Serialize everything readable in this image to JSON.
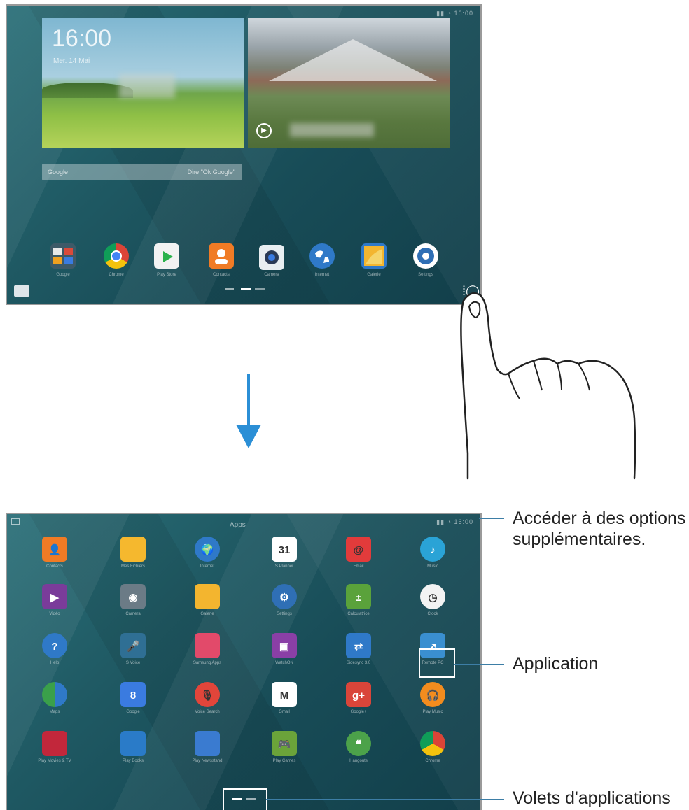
{
  "home": {
    "clock_time": "16:00",
    "clock_date": "Mer. 14 Mai",
    "search_left": "Google",
    "search_right": "Dire \"Ok Google\"",
    "dock": [
      {
        "label": "Google",
        "icon": "folder-apps-icon",
        "color": "#4a6b7a"
      },
      {
        "label": "Chrome",
        "icon": "chrome-icon",
        "color": "#e04a3a"
      },
      {
        "label": "Play Store",
        "icon": "play-store-icon",
        "color": "#f2f2f2"
      },
      {
        "label": "Contacts",
        "icon": "contacts-icon",
        "color": "#f07b25"
      },
      {
        "label": "Camera",
        "icon": "camera-icon",
        "color": "#6b7b86"
      },
      {
        "label": "Internet",
        "icon": "internet-icon",
        "color": "#2f79c8"
      },
      {
        "label": "Galerie",
        "icon": "gallery-icon",
        "color": "#f3b52f"
      },
      {
        "label": "Settings",
        "icon": "settings-icon",
        "color": "#2f6fb5"
      }
    ]
  },
  "apps": {
    "title": "Apps",
    "grid": [
      {
        "label": "Contacts",
        "icon": "contacts-icon",
        "color": "#f07b25",
        "glyph": "👤"
      },
      {
        "label": "Mes Fichiers",
        "icon": "folder-icon",
        "color": "#f5b82e",
        "glyph": ""
      },
      {
        "label": "Internet",
        "icon": "internet-icon",
        "color": "#2f79c8",
        "glyph": "🌍"
      },
      {
        "label": "S Planner",
        "icon": "calendar-icon",
        "color": "#ffffff",
        "glyph": "31"
      },
      {
        "label": "Email",
        "icon": "email-icon",
        "color": "#e23b3b",
        "glyph": "@"
      },
      {
        "label": "Music",
        "icon": "music-icon",
        "color": "#2aa3d6",
        "glyph": "♪"
      },
      {
        "label": "Vidéo",
        "icon": "video-icon",
        "color": "#7a3c9a",
        "glyph": "▶"
      },
      {
        "label": "Camera",
        "icon": "camera-icon",
        "color": "#6b7b86",
        "glyph": "◉"
      },
      {
        "label": "Galerie",
        "icon": "gallery-icon",
        "color": "#f3b52f",
        "glyph": ""
      },
      {
        "label": "Settings",
        "icon": "settings-icon",
        "color": "#2f6fb5",
        "glyph": "⚙"
      },
      {
        "label": "Calculatrice",
        "icon": "calculator-icon",
        "color": "#5aa23b",
        "glyph": "±"
      },
      {
        "label": "Clock",
        "icon": "clock-icon",
        "color": "#f3f3f3",
        "glyph": "◷"
      },
      {
        "label": "Help",
        "icon": "help-icon",
        "color": "#2f79c8",
        "glyph": "?"
      },
      {
        "label": "S Voice",
        "icon": "voice-icon",
        "color": "#2f6f94",
        "glyph": "🎤"
      },
      {
        "label": "Samsung Apps",
        "icon": "samsung-apps-icon",
        "color": "#e24a6a",
        "glyph": ""
      },
      {
        "label": "WatchON",
        "icon": "watchon-icon",
        "color": "#8a3fa6",
        "glyph": "▣"
      },
      {
        "label": "Sidesync 3.0",
        "icon": "sidesync-icon",
        "color": "#2f79c8",
        "glyph": "⇄"
      },
      {
        "label": "Remote PC",
        "icon": "remote-pc-icon",
        "color": "#3a8fd0",
        "glyph": "➚"
      },
      {
        "label": "Maps",
        "icon": "maps-icon",
        "color": "#3aa04a",
        "glyph": ""
      },
      {
        "label": "Google",
        "icon": "google-icon",
        "color": "#3a7be0",
        "glyph": "8"
      },
      {
        "label": "Voice Search",
        "icon": "voice-search-icon",
        "color": "#e2453a",
        "glyph": "🎙"
      },
      {
        "label": "Gmail",
        "icon": "gmail-icon",
        "color": "#ffffff",
        "glyph": "M"
      },
      {
        "label": "Google+",
        "icon": "google-plus-icon",
        "color": "#d9453a",
        "glyph": "g+"
      },
      {
        "label": "Play Music",
        "icon": "play-music-icon",
        "color": "#f28c1e",
        "glyph": "🎧"
      },
      {
        "label": "Play Movies & TV",
        "icon": "play-movies-icon",
        "color": "#c2273b",
        "glyph": ""
      },
      {
        "label": "Play Books",
        "icon": "play-books-icon",
        "color": "#2a7bc8",
        "glyph": ""
      },
      {
        "label": "Play Newsstand",
        "icon": "play-newsstand-icon",
        "color": "#3a7bd0",
        "glyph": ""
      },
      {
        "label": "Play Games",
        "icon": "play-games-icon",
        "color": "#6ba33a",
        "glyph": "🎮"
      },
      {
        "label": "Hangouts",
        "icon": "hangouts-icon",
        "color": "#4ca24a",
        "glyph": "❝"
      },
      {
        "label": "Chrome",
        "icon": "chrome-icon",
        "color": "#e04a3a",
        "glyph": ""
      }
    ]
  },
  "callouts": {
    "options": "Accéder à des options supplémentaires.",
    "application": "Application",
    "panels": "Volets d'applications"
  },
  "colors": {
    "accent": "#3d7ea6"
  }
}
